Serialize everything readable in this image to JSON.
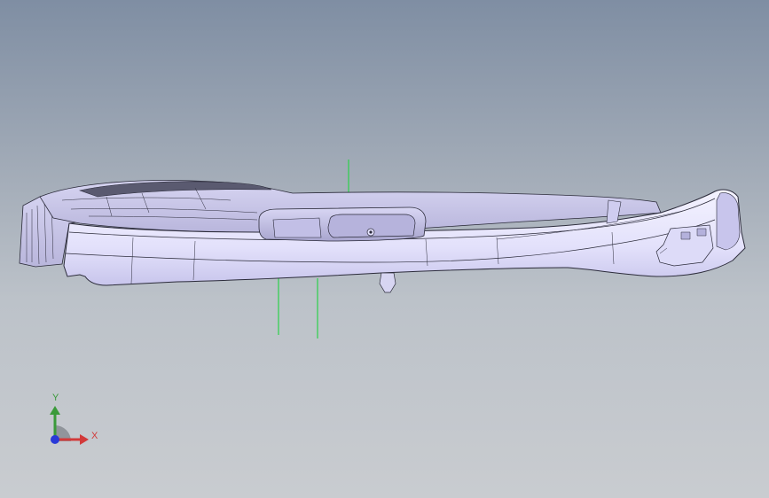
{
  "viewport": {
    "background_top": "#7f8ea3",
    "background_bottom": "#c9ccd0"
  },
  "model": {
    "part_icon": "cad-part-side-view",
    "body_color": "#ecebff",
    "shade_color": "#c9c7ec",
    "edge_color": "#2b2b3a",
    "reference_line_color": "#2bd14a"
  },
  "triad": {
    "y_label": "Y",
    "x_label": "X",
    "y_color": "#3a9a3a",
    "x_color": "#d23a3a",
    "z_color": "#2a3ad8"
  }
}
